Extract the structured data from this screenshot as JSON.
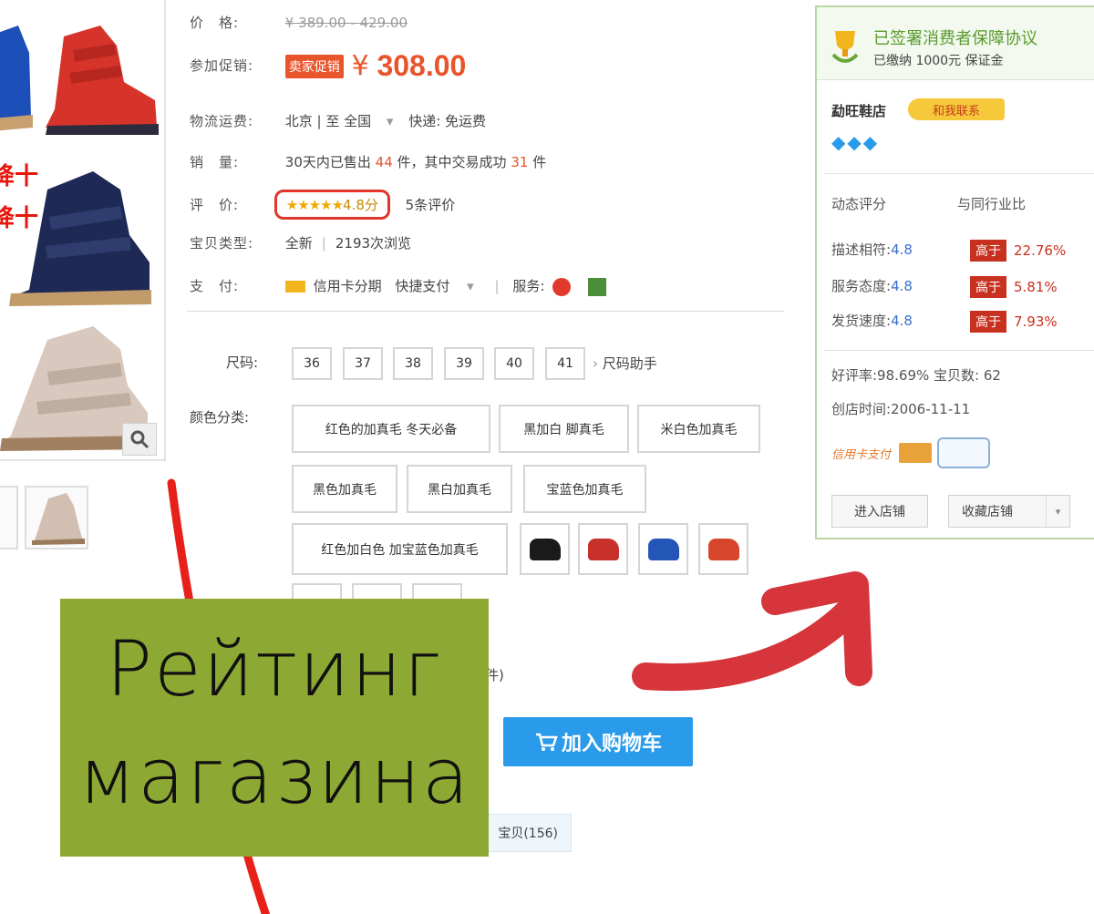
{
  "product": {
    "price_label": "价　格:",
    "original_price": "¥ 389.00 - 429.00",
    "promo_label": "参加促销:",
    "promo_tag": "卖家促销",
    "currency": "¥",
    "price": "308.00",
    "shipping_label": "物流运费:",
    "shipping_value": "北京 | 至 全国",
    "shipping_express": "快递: 免运费",
    "sales_label": "销　量:",
    "sales_prefix": "30天内已售出",
    "sales_count": "44",
    "sales_mid": "件，其中交易成功",
    "sales_success": "31",
    "sales_suffix": "件",
    "rating_label": "评　价:",
    "rating_stars": "★★★★★",
    "rating_score": "4.8分",
    "review_count": "5条评价",
    "type_label": "宝贝类型:",
    "type_value": "全新",
    "views": "2193次浏览",
    "pay_label": "支　付:",
    "pay_installment": "信用卡分期",
    "pay_quick": "快捷支付",
    "service_label": "服务:",
    "size_label": "尺码:",
    "sizes": [
      "36",
      "37",
      "38",
      "39",
      "40",
      "41"
    ],
    "size_helper": "尺码助手",
    "color_label": "颜色分类:",
    "colors": [
      "红色的加真毛 冬天必备",
      "黑加白 脚真毛",
      "米白色加真毛",
      "黑色加真毛",
      "黑白加真毛",
      "宝蓝色加真毛",
      "红色加白色 加宝蓝色加真毛"
    ],
    "swatch_colors": [
      "#1a1a1a",
      "#c8302a",
      "#2456b8",
      "#d8452d"
    ],
    "quantity_partial": "件)",
    "add_to_cart": "加入购物车",
    "favorites_partial": "宝贝(156)"
  },
  "promo_overlay": {
    "promo_line1": "降十",
    "promo_line2": "降十"
  },
  "shop": {
    "guarantee_title": "已签署消费者保障协议",
    "deposit": "已缴纳 1000元 保证金",
    "shop_name": "勐旺鞋店",
    "contact_badge": "和我联系",
    "diamonds": "◆◆◆",
    "dynamic_header": "动态评分",
    "compare_header": "与同行业比",
    "scores": [
      {
        "label": "描述相符:",
        "value": "4.8",
        "badge": "高于",
        "pct": "22.76%"
      },
      {
        "label": "服务态度:",
        "value": "4.8",
        "badge": "高于",
        "pct": "5.81%"
      },
      {
        "label": "发货速度:",
        "value": "4.8",
        "badge": "高于",
        "pct": "7.93%"
      }
    ],
    "good_rate": "好评率:98.69%",
    "items_count": "宝贝数: 62",
    "opened": "创店时间:2006-11-11",
    "credit_label": "信用卡支付",
    "enter_shop": "进入店铺",
    "favorite_shop": "收藏店铺"
  },
  "caption": {
    "line1": "Рейтинг",
    "line2": "магазина"
  },
  "colors": {
    "accent": "#e8542b",
    "overlay": "#8ea834",
    "arrow": "#d5353b",
    "cart": "#2a9bea",
    "shop_border": "#b9d6a7"
  }
}
